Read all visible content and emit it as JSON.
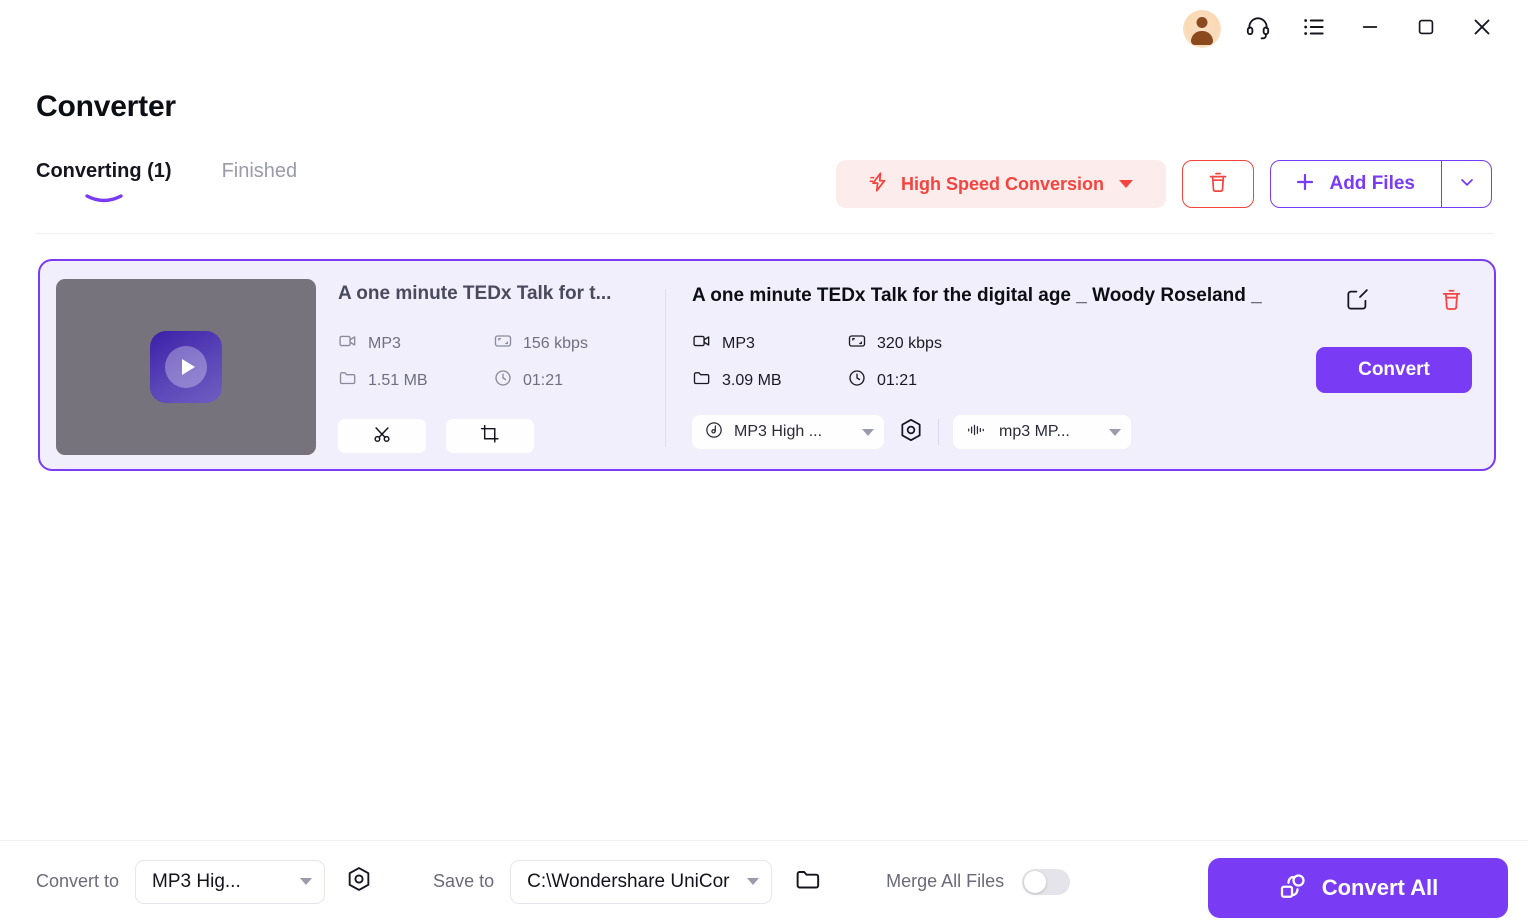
{
  "titlebar": {
    "icons": [
      {
        "name": "account-avatar",
        "label": "account"
      },
      {
        "name": "headset-support-icon",
        "label": "support"
      },
      {
        "name": "menu-list-icon",
        "label": "menu"
      },
      {
        "name": "minimize-icon",
        "label": "minimize"
      },
      {
        "name": "maximize-icon",
        "label": "maximize"
      },
      {
        "name": "close-icon",
        "label": "close"
      }
    ]
  },
  "header": {
    "title": "Converter"
  },
  "tabs": [
    {
      "label": "Converting (1)",
      "active": true
    },
    {
      "label": "Finished",
      "active": false
    }
  ],
  "toolbar": {
    "high_speed_label": "High Speed Conversion",
    "high_speed_icon": "lightning-bolt-icon",
    "clear_icon": "trash-icon",
    "add_files_label": "Add Files",
    "add_files_icon": "plus-icon",
    "add_files_dropdown_icon": "chevron-down-icon"
  },
  "colors": {
    "accent_purple": "#7a3bf5",
    "accent_red": "#f4443f",
    "card_bg": "#f2effc",
    "high_speed_bg": "#fdecec"
  },
  "file_card": {
    "thumbnail_icon": "video-music-play-icon",
    "source": {
      "title": "A one minute TEDx Talk for t...",
      "format": "MP3",
      "format_icon": "video-camera-icon",
      "bitrate": "156 kbps",
      "bitrate_icon": "resolution-icon",
      "size": "1.51 MB",
      "size_icon": "folder-icon",
      "duration": "01:21",
      "duration_icon": "clock-icon",
      "trim_icon": "scissors-icon",
      "crop_icon": "crop-icon"
    },
    "target": {
      "title": "A one minute TEDx Talk for the digital age _ Woody Roseland _ ...",
      "format": "MP3",
      "format_icon": "video-camera-icon",
      "bitrate": "320 kbps",
      "bitrate_icon": "resolution-icon",
      "size": "3.09 MB",
      "size_icon": "folder-icon",
      "duration": "01:21",
      "duration_icon": "clock-icon",
      "quality_select": "MP3 High ...",
      "quality_select_icon": "music-disc-icon",
      "settings_icon": "settings-hex-icon",
      "codec_select": "mp3 MP...",
      "codec_select_icon": "audio-waveform-icon"
    },
    "edit_icon": "edit-pencil-square-icon",
    "delete_icon": "trash-icon",
    "convert_label": "Convert"
  },
  "bottombar": {
    "convert_to_label": "Convert to",
    "convert_to_value": "MP3 Hig...",
    "convert_to_settings_icon": "settings-hex-icon",
    "save_to_label": "Save to",
    "save_to_value": "C:\\Wondershare UniCor",
    "save_to_folder_icon": "folder-open-icon",
    "merge_label": "Merge All Files",
    "merge_enabled": false,
    "convert_all_label": "Convert All",
    "convert_all_icon": "convert-all-icon"
  }
}
